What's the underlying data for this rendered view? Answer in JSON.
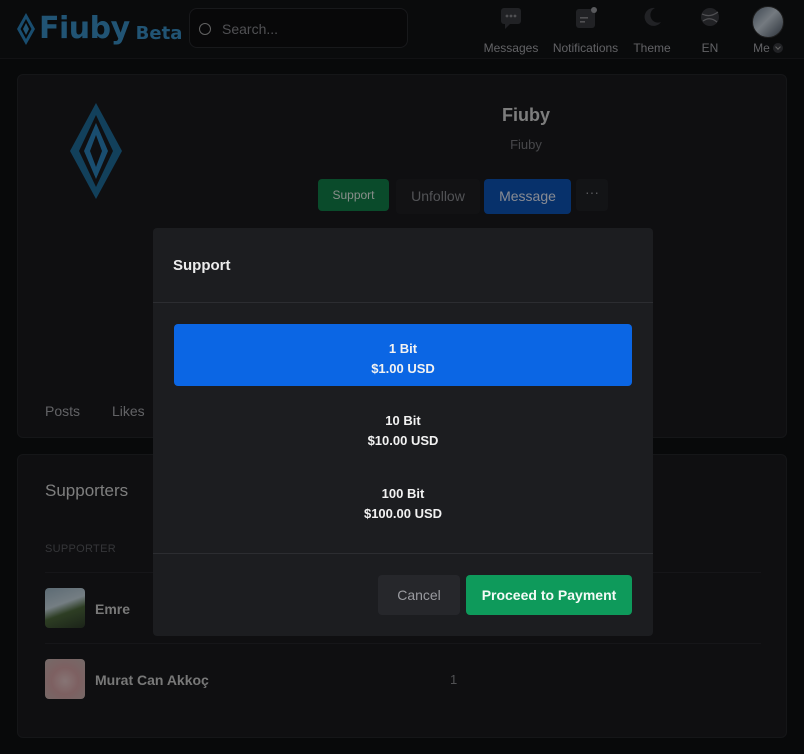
{
  "app": {
    "brand": "Fiuby",
    "badge": "Beta"
  },
  "search": {
    "placeholder": "Search..."
  },
  "nav": {
    "messages": "Messages",
    "notifications": "Notifications",
    "theme": "Theme",
    "language": "EN",
    "me": "Me"
  },
  "profile": {
    "name": "Fiuby",
    "handle": "Fiuby",
    "buttons": {
      "support": "Support",
      "unfollow": "Unfollow",
      "message": "Message",
      "more": "···"
    },
    "tabs": [
      "Posts",
      "Likes"
    ]
  },
  "supporters": {
    "title": "Supporters",
    "column_header": "SUPPORTER",
    "rows": [
      {
        "name": "Emre",
        "count": ""
      },
      {
        "name": "Murat Can Akkoç",
        "count": "1"
      }
    ]
  },
  "modal": {
    "title": "Support",
    "options": [
      {
        "amount": "1 Bit",
        "price": "$1.00 USD",
        "selected": true
      },
      {
        "amount": "10 Bit",
        "price": "$10.00 USD",
        "selected": false
      },
      {
        "amount": "100 Bit",
        "price": "$100.00 USD",
        "selected": false
      }
    ],
    "cancel": "Cancel",
    "proceed": "Proceed to Payment"
  },
  "colors": {
    "brand": "#3a92c9",
    "selected_option": "#0b66e4",
    "proceed": "#0e9a5b",
    "support_button": "#12824b",
    "message_button": "#0d55b8"
  }
}
